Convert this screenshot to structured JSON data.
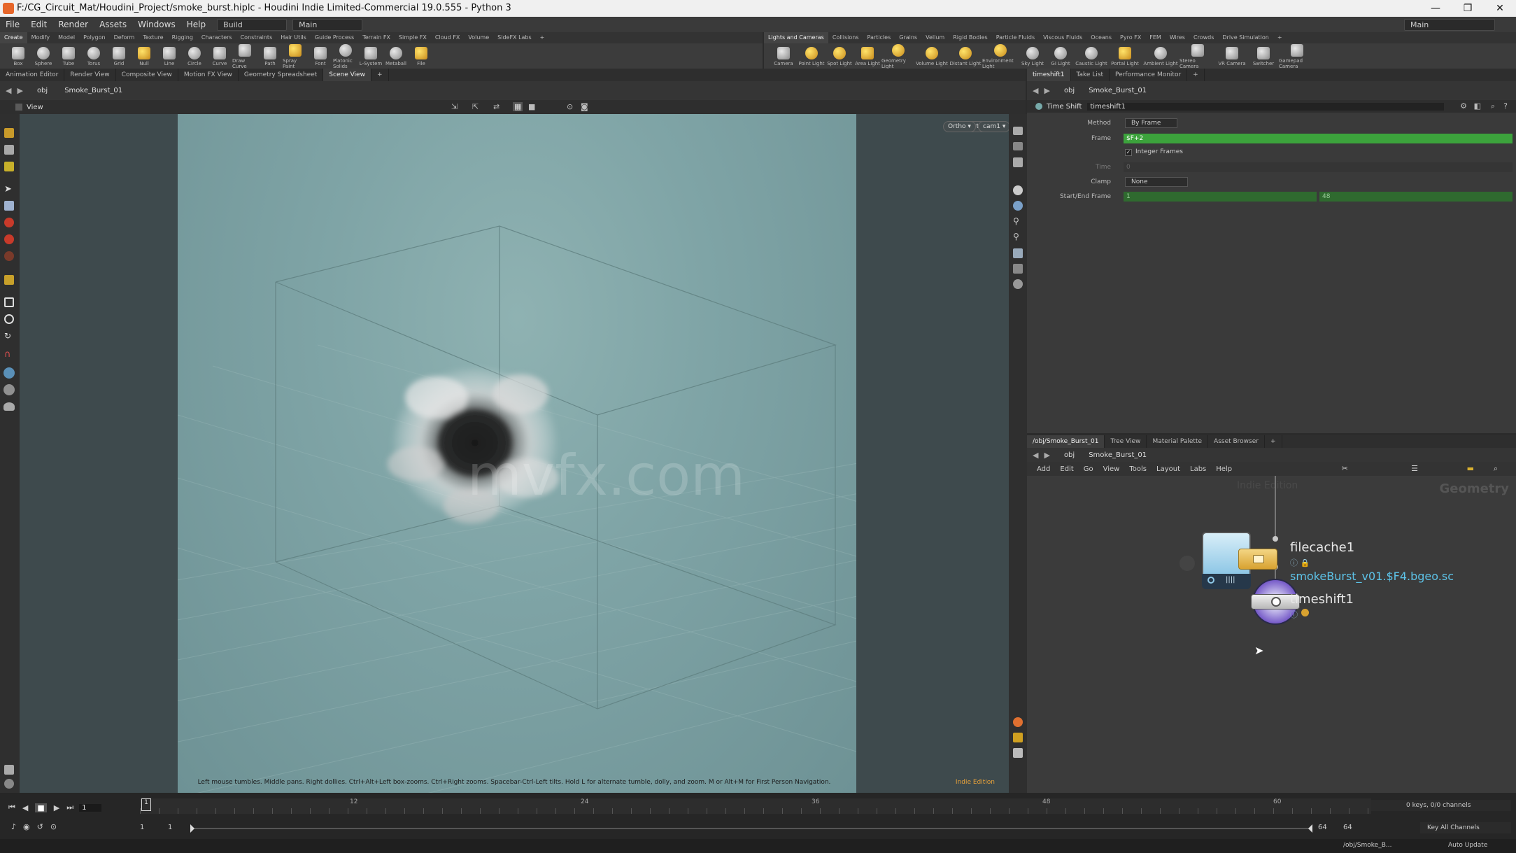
{
  "window": {
    "title": "F:/CG_Circuit_Mat/Houdini_Project/smoke_burst.hiplc - Houdini Indie Limited-Commercial 19.0.555 - Python 3",
    "controls": [
      "—",
      "❐",
      "✕"
    ]
  },
  "menubar": {
    "items": [
      "File",
      "Edit",
      "Render",
      "Assets",
      "Windows",
      "Help"
    ],
    "desktop": "Build",
    "context": "Main",
    "right_context": "Main"
  },
  "shelf_left": {
    "tabs": [
      "Create",
      "Modify",
      "Model",
      "Polygon",
      "Deform",
      "Texture",
      "Rigging",
      "Characters",
      "Constraints",
      "Hair Utils",
      "Guide Process",
      "Terrain FX",
      "Simple FX",
      "Cloud FX",
      "Volume",
      "SideFX Labs"
    ],
    "tools": [
      "Box",
      "Sphere",
      "Tube",
      "Torus",
      "Grid",
      "Null",
      "Line",
      "Circle",
      "Curve",
      "Draw Curve",
      "Path",
      "Spray Paint",
      "Font",
      "Platonic Solids",
      "L-System",
      "Metaball",
      "File"
    ]
  },
  "shelf_right": {
    "tabs": [
      "Lights and Cameras",
      "Collisions",
      "Particles",
      "Grains",
      "Vellum",
      "Rigid Bodies",
      "Particle Fluids",
      "Viscous Fluids",
      "Oceans",
      "Pyro FX",
      "FEM",
      "Wires",
      "Crowds",
      "Drive Simulation"
    ],
    "tools": [
      "Camera",
      "Point Light",
      "Spot Light",
      "Area Light",
      "Geometry Light",
      "Volume Light",
      "Distant Light",
      "Environment Light",
      "Sky Light",
      "GI Light",
      "Caustic Light",
      "Portal Light",
      "Ambient Light",
      "Stereo Camera",
      "VR Camera",
      "Switcher",
      "Gamepad Camera"
    ]
  },
  "left_pane_tabs": [
    "Animation Editor",
    "Render View",
    "Composite View",
    "Motion FX View",
    "Geometry Spreadsheet",
    "Scene View"
  ],
  "right_pane_tabs": [
    "timeshift1",
    "Take List",
    "Performance Monitor"
  ],
  "viewport": {
    "path_root": "obj",
    "path_node": "Smoke_Burst_01",
    "label": "View",
    "persp_button": "Ortho ▾",
    "cam_button": "cam1 ▾",
    "help_text": "Left mouse tumbles. Middle pans. Right dollies. Ctrl+Alt+Left box-zooms. Ctrl+Right zooms. Spacebar-Ctrl-Left tilts. Hold L for alternate tumble, dolly, and zoom.     M or Alt+M for First Person Navigation.",
    "edition": "Indie Edition",
    "watermark": "mvfx.com"
  },
  "params": {
    "path_root": "obj",
    "path_node": "Smoke_Burst_01",
    "node_type": "Time Shift",
    "node_name": "timeshift1",
    "method_label": "Method",
    "method_value": "By Frame",
    "frame_label": "Frame",
    "frame_value": "$F+2",
    "integer_frames_label": "Integer Frames",
    "time_label": "Time",
    "time_value": "0",
    "clamp_label": "Clamp",
    "clamp_value": "None",
    "startend_label": "Start/End Frame",
    "start_value": "1",
    "end_value": "48"
  },
  "network": {
    "tabs": [
      "/obj/Smoke_Burst_01",
      "Tree View",
      "Material Palette",
      "Asset Browser"
    ],
    "path_root": "obj",
    "path_node": "Smoke_Burst_01",
    "menu": [
      "Add",
      "Edit",
      "Go",
      "View",
      "Tools",
      "Layout",
      "Labs",
      "Help"
    ],
    "context_label": "Geometry",
    "edition_label": "Indie Edition",
    "nodes": [
      {
        "name": "filecache1",
        "sub": "smokeBurst_v01.$F4.bgeo.sc"
      },
      {
        "name": "timeshift1",
        "sub": ""
      }
    ]
  },
  "timeline": {
    "current_frame": "1",
    "start_frame": "1",
    "start_frame2": "1",
    "end_frame": "64",
    "end_frame2": "64",
    "ticks": [
      "1",
      "12",
      "24",
      "36",
      "48",
      "60"
    ],
    "keys_status": "0 keys, 0/0 channels",
    "key_all": "Key All Channels",
    "status_path": "/obj/Smoke_B...",
    "auto_update": "Auto Update"
  }
}
